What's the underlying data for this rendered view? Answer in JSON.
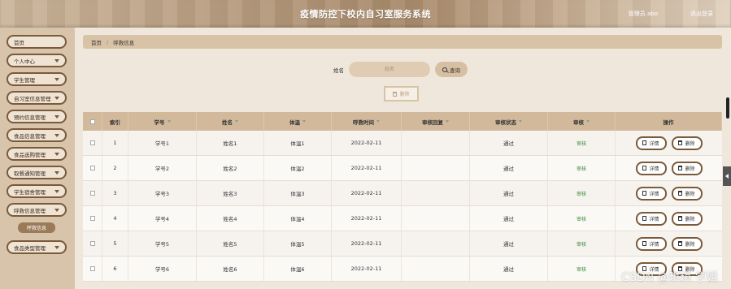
{
  "header": {
    "title": "疫情防控下校内自习室服务系统",
    "user": "管理员 abo",
    "logout": "退出登录"
  },
  "sidebar": {
    "items": [
      {
        "label": "首页",
        "arrow": false
      },
      {
        "label": "个人中心",
        "arrow": true
      },
      {
        "label": "学生管理",
        "arrow": true
      },
      {
        "label": "自习室信息管理",
        "arrow": true
      },
      {
        "label": "预约信息管理",
        "arrow": true
      },
      {
        "label": "食品信息管理",
        "arrow": true
      },
      {
        "label": "食品选购管理",
        "arrow": true
      },
      {
        "label": "取餐通知管理",
        "arrow": true
      },
      {
        "label": "学生宿舍管理",
        "arrow": true
      },
      {
        "label": "呼救信息管理",
        "arrow": true
      },
      {
        "label": "食品类型管理",
        "arrow": true
      }
    ],
    "active_sub": "呼救信息"
  },
  "breadcrumb": {
    "home": "首页",
    "separator": "/",
    "current": "呼救信息"
  },
  "search": {
    "label": "姓名",
    "placeholder": "姓名",
    "button": "查询"
  },
  "delete_all": "删除",
  "table": {
    "headers": [
      "索引",
      "学号",
      "姓名",
      "体温",
      "呼救时间",
      "审核回复",
      "审核状态",
      "审核",
      "操作"
    ],
    "rows": [
      {
        "index": "1",
        "student_no": "学号1",
        "name": "姓名1",
        "temp": "体温1",
        "time": "2022-02-11",
        "reply": "",
        "status": "通过",
        "audit": "审核",
        "detail": "详情",
        "delete": "删除"
      },
      {
        "index": "2",
        "student_no": "学号2",
        "name": "姓名2",
        "temp": "体温2",
        "time": "2022-02-11",
        "reply": "",
        "status": "通过",
        "audit": "审核",
        "detail": "详情",
        "delete": "删除"
      },
      {
        "index": "3",
        "student_no": "学号3",
        "name": "姓名3",
        "temp": "体温3",
        "time": "2022-02-11",
        "reply": "",
        "status": "通过",
        "audit": "审核",
        "detail": "详情",
        "delete": "删除"
      },
      {
        "index": "4",
        "student_no": "学号4",
        "name": "姓名4",
        "temp": "体温4",
        "time": "2022-02-11",
        "reply": "",
        "status": "通过",
        "audit": "审核",
        "detail": "详情",
        "delete": "删除"
      },
      {
        "index": "5",
        "student_no": "学号5",
        "name": "姓名5",
        "temp": "体温5",
        "time": "2022-02-11",
        "reply": "",
        "status": "通过",
        "audit": "审核",
        "detail": "详情",
        "delete": "删除"
      },
      {
        "index": "6",
        "student_no": "学号6",
        "name": "姓名6",
        "temp": "体温6",
        "time": "2022-02-11",
        "reply": "",
        "status": "通过",
        "audit": "审核",
        "detail": "详情",
        "delete": "删除"
      }
    ]
  },
  "watermark": "CSDN @琪琪 学姐",
  "colors": {
    "header": "#b89d80",
    "sidebar": "#d8c4ab",
    "accent": "#7a5a3a",
    "audit": "#3a8a3a"
  }
}
